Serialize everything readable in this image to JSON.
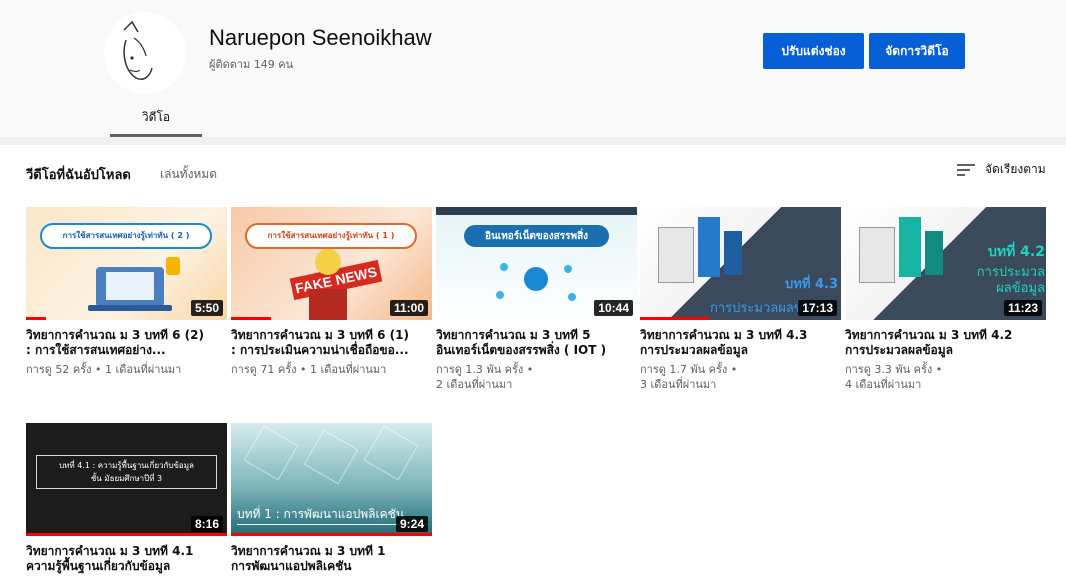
{
  "channel": {
    "name": "Naruepon Seenoikhaw",
    "subscribers": "ผู้ติดตาม 149 คน",
    "customize_label": "ปรับแต่งช่อง",
    "manage_label": "จัดการวิดีโอ",
    "tab_label": "วิดีโอ"
  },
  "section": {
    "title": "วีดีโอที่ฉันอัปโหลด",
    "play_all": "เล่นทั้งหมด",
    "sort_label": "จัดเรียงตาม"
  },
  "videos": [
    {
      "thumb_text": "การใช้สารสนเทศอย่างรู้เท่าทัน ( 2 )",
      "duration": "5:50",
      "progress": 0.1,
      "title_line1": "วิทยาการคำนวณ ม 3 บทที่ 6 (2)",
      "title_line2": ": การใช้สารสนเทศอย่าง...",
      "meta_line1": "การดู 52 ครั้ง • 1 เดือนที่ผ่านมา",
      "meta_line2": ""
    },
    {
      "thumb_text": "การใช้สารสนเทศอย่างรู้เท่าทัน ( 1 )",
      "duration": "11:00",
      "progress": 0.2,
      "title_line1": "วิทยาการคำนวณ ม 3 บทที่ 6 (1)",
      "title_line2": ": การประเมินความน่าเชื่อถือขอ...",
      "meta_line1": "การดู 71 ครั้ง • 1 เดือนที่ผ่านมา",
      "meta_line2": ""
    },
    {
      "thumb_text": "อินเทอร์เน็ตของสรรพสิ่ง",
      "duration": "10:44",
      "progress": 0.0,
      "title_line1": "วิทยาการคำนวณ ม 3 บทที่ 5",
      "title_line2": "อินเทอร์เน็ตของสรรพสิ่ง ( IOT )",
      "meta_line1": "การดู 1.3 พัน ครั้ง •",
      "meta_line2": "2 เดือนที่ผ่านมา"
    },
    {
      "thumb_text": "บทที่ 4.3",
      "thumb_text2": "การประมวลผลข้อมูล",
      "duration": "17:13",
      "progress": 0.35,
      "title_line1": "วิทยาการคำนวณ ม 3 บทที่ 4.3",
      "title_line2": "การประมวลผลข้อมูล",
      "meta_line1": "การดู 1.7 พัน ครั้ง •",
      "meta_line2": "3 เดือนที่ผ่านมา"
    },
    {
      "thumb_text": "บทที่ 4.2",
      "thumb_text2": "การประมวล",
      "thumb_text3": "ผลข้อมูล",
      "duration": "11:23",
      "progress": 0.0,
      "title_line1": "วิทยาการคำนวณ ม 3 บทที่ 4.2",
      "title_line2": "การประมวลผลข้อมูล",
      "meta_line1": "การดู 3.3 พัน ครั้ง •",
      "meta_line2": "4 เดือนที่ผ่านมา"
    },
    {
      "thumb_text": "บทที่ 4.1 : ความรู้พื้นฐานเกี่ยวกับข้อมูล",
      "thumb_text2": "ชั้น มัธยมศึกษาปีที่ 3",
      "duration": "8:16",
      "progress": 1.0,
      "title_line1": "วิทยาการคำนวณ ม 3 บทที่ 4.1",
      "title_line2": "ความรู้พื้นฐานเกี่ยวกับข้อมูล",
      "meta_line1": "",
      "meta_line2": ""
    },
    {
      "thumb_text": "บทที่ 1 : การพัฒนาแอปพลิเคชัน",
      "duration": "9:24",
      "progress": 1.0,
      "title_line1": "วิทยาการคำนวณ ม 3 บทที่ 1",
      "title_line2": "การพัฒนาแอปพลิเคชัน",
      "meta_line1": "",
      "meta_line2": ""
    }
  ],
  "colors": {
    "primary_button": "#065fd4",
    "progress_red": "#ff0000",
    "header_bg": "#f9f9f9"
  }
}
